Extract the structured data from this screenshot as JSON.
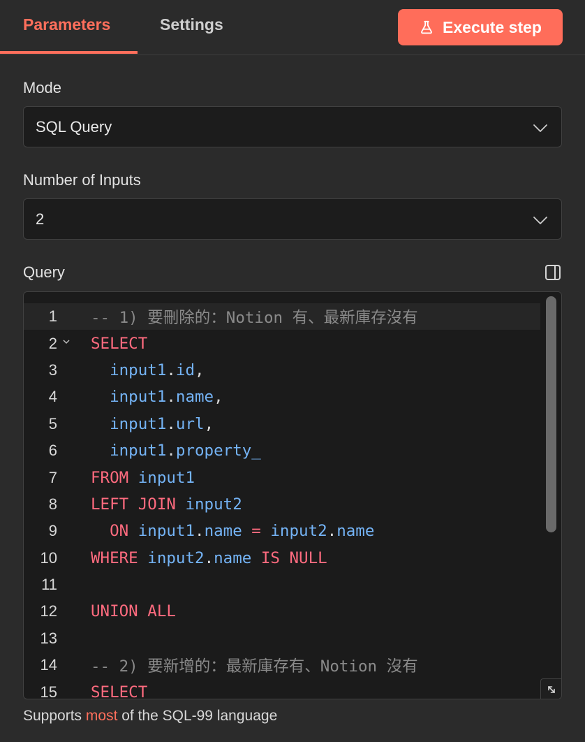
{
  "tabs": [
    {
      "label": "Parameters",
      "active": true
    },
    {
      "label": "Settings",
      "active": false
    }
  ],
  "execute_button": {
    "label": "Execute step",
    "icon": "flask-icon"
  },
  "mode": {
    "label": "Mode",
    "value": "SQL Query"
  },
  "inputs": {
    "label": "Number of Inputs",
    "value": "2"
  },
  "query": {
    "label": "Query",
    "lines": [
      {
        "n": "1",
        "tokens": [
          {
            "t": "-- 1) 要刪除的：Notion 有、最新庫存沒有",
            "c": "c"
          }
        ]
      },
      {
        "n": "2",
        "fold": true,
        "tokens": [
          {
            "t": "SELECT",
            "c": "k"
          }
        ]
      },
      {
        "n": "3",
        "tokens": [
          {
            "t": "  ",
            "c": "p"
          },
          {
            "t": "input1",
            "c": "i"
          },
          {
            "t": ".",
            "c": "p"
          },
          {
            "t": "id",
            "c": "i"
          },
          {
            "t": ",",
            "c": "p"
          }
        ]
      },
      {
        "n": "4",
        "tokens": [
          {
            "t": "  ",
            "c": "p"
          },
          {
            "t": "input1",
            "c": "i"
          },
          {
            "t": ".",
            "c": "p"
          },
          {
            "t": "name",
            "c": "i"
          },
          {
            "t": ",",
            "c": "p"
          }
        ]
      },
      {
        "n": "5",
        "tokens": [
          {
            "t": "  ",
            "c": "p"
          },
          {
            "t": "input1",
            "c": "i"
          },
          {
            "t": ".",
            "c": "p"
          },
          {
            "t": "url",
            "c": "i"
          },
          {
            "t": ",",
            "c": "p"
          }
        ]
      },
      {
        "n": "6",
        "tokens": [
          {
            "t": "  ",
            "c": "p"
          },
          {
            "t": "input1",
            "c": "i"
          },
          {
            "t": ".",
            "c": "p"
          },
          {
            "t": "property_",
            "c": "i"
          }
        ]
      },
      {
        "n": "7",
        "tokens": [
          {
            "t": "FROM",
            "c": "k"
          },
          {
            "t": " ",
            "c": "p"
          },
          {
            "t": "input1",
            "c": "i"
          }
        ]
      },
      {
        "n": "8",
        "tokens": [
          {
            "t": "LEFT JOIN",
            "c": "k"
          },
          {
            "t": " ",
            "c": "p"
          },
          {
            "t": "input2",
            "c": "i"
          }
        ]
      },
      {
        "n": "9",
        "tokens": [
          {
            "t": "  ",
            "c": "p"
          },
          {
            "t": "ON",
            "c": "k"
          },
          {
            "t": " ",
            "c": "p"
          },
          {
            "t": "input1",
            "c": "i"
          },
          {
            "t": ".",
            "c": "p"
          },
          {
            "t": "name",
            "c": "i"
          },
          {
            "t": " ",
            "c": "p"
          },
          {
            "t": "=",
            "c": "k"
          },
          {
            "t": " ",
            "c": "p"
          },
          {
            "t": "input2",
            "c": "i"
          },
          {
            "t": ".",
            "c": "p"
          },
          {
            "t": "name",
            "c": "i"
          }
        ]
      },
      {
        "n": "10",
        "tokens": [
          {
            "t": "WHERE",
            "c": "k"
          },
          {
            "t": " ",
            "c": "p"
          },
          {
            "t": "input2",
            "c": "i"
          },
          {
            "t": ".",
            "c": "p"
          },
          {
            "t": "name",
            "c": "i"
          },
          {
            "t": " ",
            "c": "p"
          },
          {
            "t": "IS NULL",
            "c": "k"
          }
        ]
      },
      {
        "n": "11",
        "tokens": []
      },
      {
        "n": "12",
        "tokens": [
          {
            "t": "UNION ALL",
            "c": "k"
          }
        ]
      },
      {
        "n": "13",
        "tokens": []
      },
      {
        "n": "14",
        "tokens": [
          {
            "t": "-- 2) 要新增的：最新庫存有、Notion 沒有",
            "c": "c"
          }
        ]
      },
      {
        "n": "15",
        "tokens": [
          {
            "t": "SELECT",
            "c": "k"
          }
        ]
      }
    ]
  },
  "hint": {
    "prefix": "Supports ",
    "link": "most",
    "suffix": " of the SQL-99 language"
  },
  "colors": {
    "accent": "#ff6d5a",
    "keyword": "#ff6b7f",
    "identifier": "#74b3f5",
    "comment": "#8a8a8a"
  }
}
